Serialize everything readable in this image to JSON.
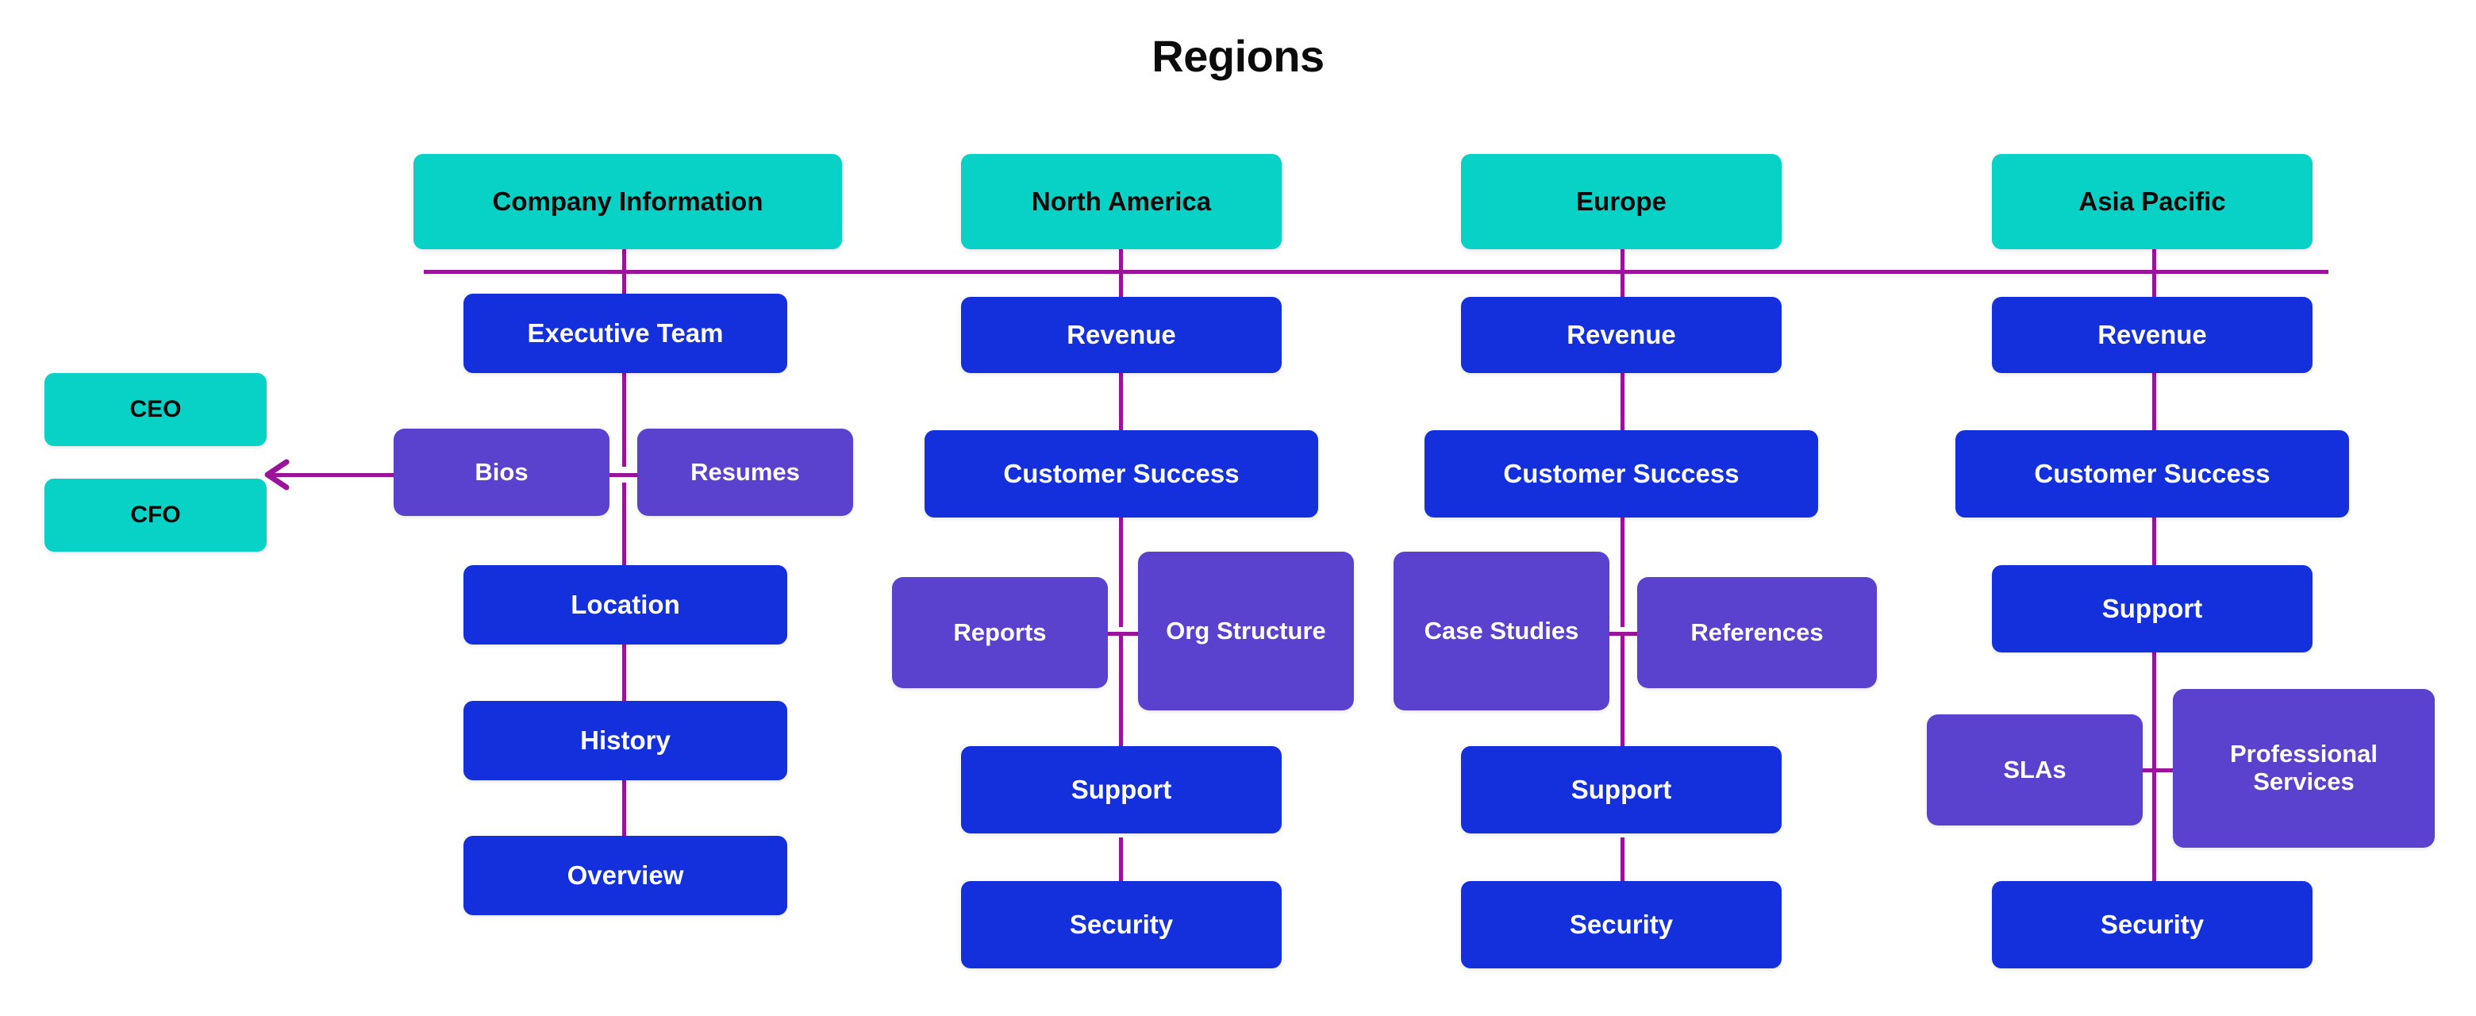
{
  "diagram": {
    "title": "Regions",
    "colors": {
      "teal": "#08d2c6",
      "blue": "#1430dc",
      "purple": "#5a42ce",
      "connector": "#9b139b",
      "background": "#ffffff",
      "dark_text": "#0b0b0b",
      "light_text": "#ffffff"
    },
    "officers": [
      {
        "label": "CEO"
      },
      {
        "label": "CFO"
      }
    ],
    "columns": [
      {
        "header": "Company Information",
        "nodes": [
          {
            "label": "Executive Team"
          },
          {
            "label": "Location"
          },
          {
            "label": "History"
          },
          {
            "label": "Overview"
          }
        ],
        "branch_left": "Bios",
        "branch_right": "Resumes"
      },
      {
        "header": "North America",
        "nodes": [
          {
            "label": "Revenue"
          },
          {
            "label": "Customer Success"
          },
          {
            "label": "Support"
          },
          {
            "label": "Security"
          }
        ],
        "branch_left": "Reports",
        "branch_right": "Org Structure"
      },
      {
        "header": "Europe",
        "nodes": [
          {
            "label": "Revenue"
          },
          {
            "label": "Customer Success"
          },
          {
            "label": "Support"
          },
          {
            "label": "Security"
          }
        ],
        "branch_left": "Case Studies",
        "branch_right": "References"
      },
      {
        "header": "Asia Pacific",
        "nodes": [
          {
            "label": "Revenue"
          },
          {
            "label": "Customer Success"
          },
          {
            "label": "Support"
          },
          {
            "label": "Security"
          }
        ],
        "branch_left": "SLAs",
        "branch_right": "Professional Services"
      }
    ]
  }
}
